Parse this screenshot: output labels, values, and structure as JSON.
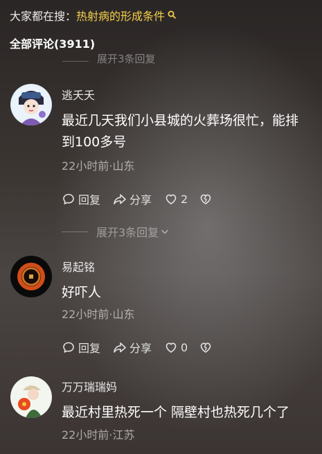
{
  "header": {
    "search_prefix": "大家都在搜：",
    "search_keyword": "热射病的形成条件",
    "comment_count": "全部评论(3911)"
  },
  "collapsed_top": {
    "label": "展开3条回复"
  },
  "comments": [
    {
      "username": "逃夭夭",
      "content": "最近几天我们小县城的火葬场很忙，能排到100多号",
      "meta": "22小时前·山东",
      "reply_label": "回复",
      "share_label": "分享",
      "likes": "2",
      "expand_label": "展开3条回复"
    },
    {
      "username": "易起铭",
      "content": "好吓人",
      "meta": "22小时前·山东",
      "reply_label": "回复",
      "share_label": "分享",
      "likes": "0"
    },
    {
      "username": "万万瑞瑞妈",
      "content": "最近村里热死一个 隔壁村也热死几个了",
      "meta": "22小时前·江苏"
    }
  ],
  "colors": {
    "keyword": "#f6cf4b",
    "text": "#ffffff",
    "muted": "#b4b4b4"
  },
  "icons": [
    "search-icon",
    "reply-icon",
    "share-icon",
    "heart-icon",
    "broken-heart-icon",
    "chevron-down-icon"
  ]
}
